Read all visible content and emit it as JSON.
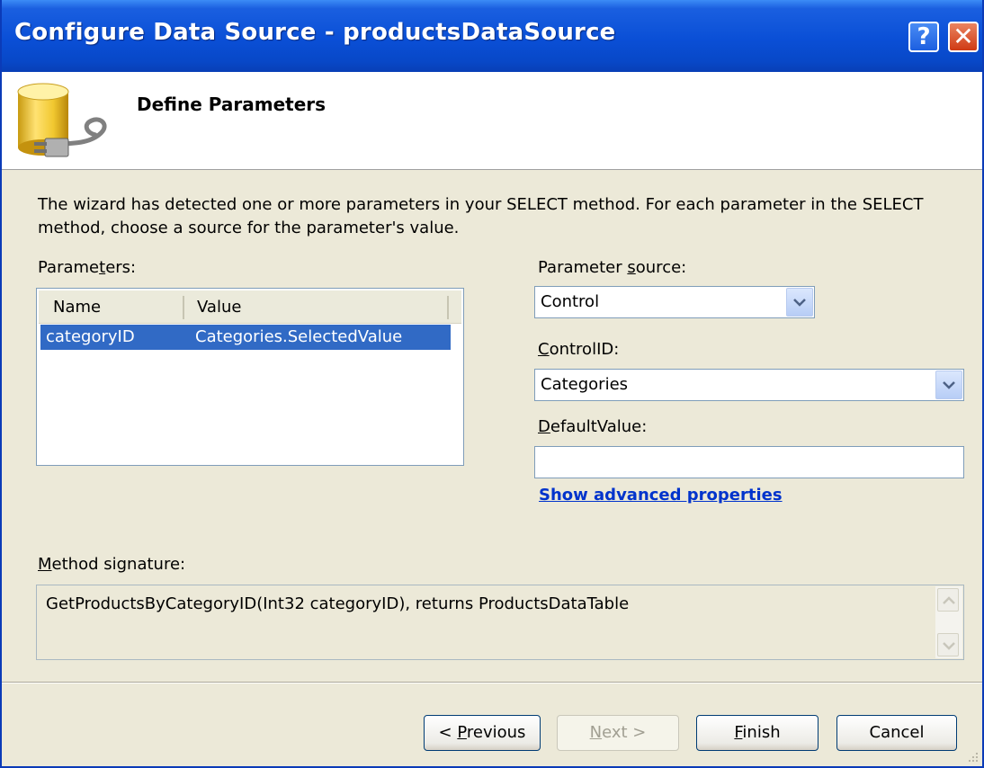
{
  "window": {
    "title": "Configure Data Source - productsDataSource",
    "help_glyph": "?",
    "close_glyph": "✕"
  },
  "header": {
    "title": "Define Parameters"
  },
  "intro_text": "The wizard has detected one or more parameters in your SELECT method. For each parameter in the SELECT method, choose a source for the parameter's value.",
  "parameters": {
    "label_pre": "Parame",
    "label_accel": "t",
    "label_post": "ers:",
    "columns": [
      "Name",
      "Value"
    ],
    "rows": [
      {
        "name": "categoryID",
        "value": "Categories.SelectedValue",
        "selected": true
      }
    ]
  },
  "parameter_source": {
    "label_pre": "Parameter ",
    "label_accel": "s",
    "label_post": "ource:",
    "value": "Control"
  },
  "control_id": {
    "label_accel": "C",
    "label_post": "ontrolID:",
    "value": "Categories"
  },
  "default_value": {
    "label_accel": "D",
    "label_post": "efaultValue:",
    "value": ""
  },
  "advanced_link": "Show advanced properties",
  "method_signature": {
    "label_accel": "M",
    "label_post": "ethod signature:",
    "text": "GetProductsByCategoryID(Int32 categoryID), returns ProductsDataTable"
  },
  "buttons": {
    "previous": {
      "pre": "< ",
      "accel": "P",
      "post": "revious"
    },
    "next": {
      "pre": "",
      "accel": "N",
      "post": "ext >"
    },
    "finish": {
      "pre": "",
      "accel": "F",
      "post": "inish"
    },
    "cancel": "Cancel"
  },
  "colors": {
    "titlebar": "#0a4fd6",
    "selection": "#316ac5",
    "dialog_bg": "#ece9d8",
    "link": "#0033cc"
  }
}
